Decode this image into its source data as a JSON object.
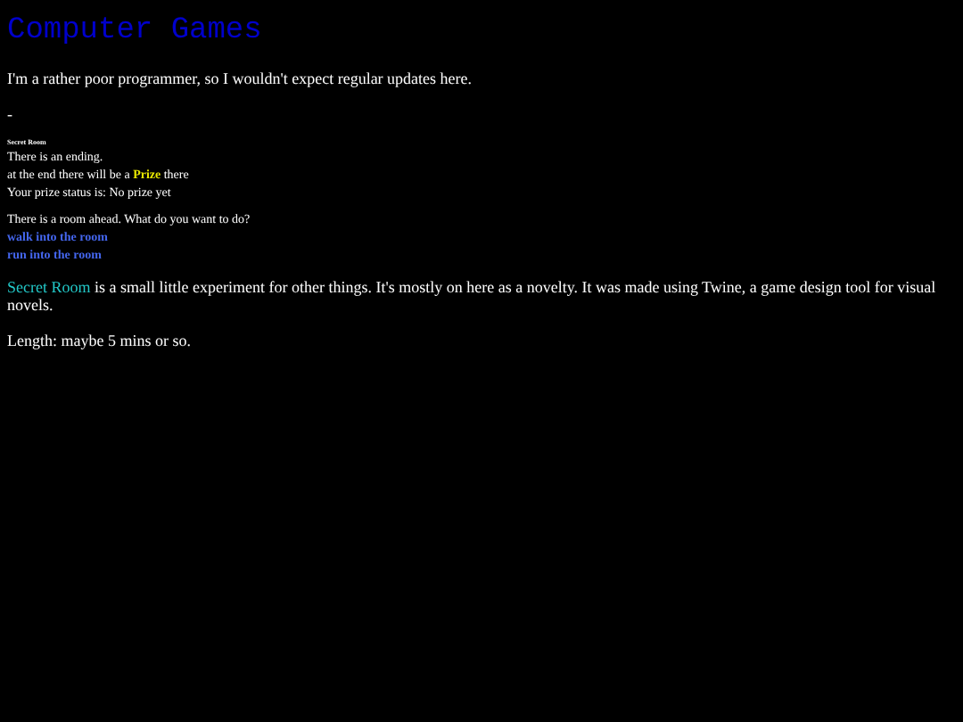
{
  "title": "Computer Games",
  "intro": "I'm a rather poor programmer, so I wouldn't expect regular updates here.",
  "separator": "-",
  "game_frame": {
    "title": "Secret Room",
    "lines": [
      "There is an ending.",
      "at the end there will be a **Prize** there",
      "Your prize status is: No prize yet"
    ],
    "prompt": "There is a room ahead. What do you want to do?",
    "choices": [
      "walk into the room",
      "run into the room"
    ]
  },
  "description": {
    "link": "Secret Room",
    "text": "is a small little experiment for other things. It's mostly on here as a novelty. It was made using Twine, a game design tool for visual novels."
  },
  "length": "Length: maybe 5 mins or so."
}
